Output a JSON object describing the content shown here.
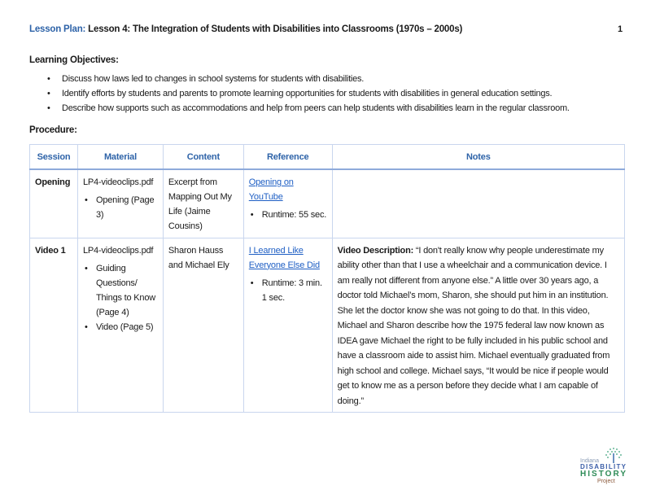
{
  "header": {
    "label": "Lesson Plan:",
    "title": "Lesson 4: The Integration of Students with Disabilities into Classrooms (1970s – 2000s)",
    "page_number": "1"
  },
  "objectives": {
    "heading": "Learning Objectives:",
    "items": [
      "Discuss how laws led to changes in school systems for students with disabilities.",
      "Identify efforts by students and parents to promote learning opportunities for students with disabilities in general education settings.",
      "Describe how supports such as accommodations and help from peers can help students with disabilities learn in the regular classroom."
    ]
  },
  "procedure": {
    "heading": "Procedure:",
    "columns": [
      "Session",
      "Material",
      "Content",
      "Reference",
      "Notes"
    ],
    "rows": [
      {
        "session": "Opening",
        "material_file": "LP4-videoclips.pdf",
        "material_items": [
          "Opening (Page 3)"
        ],
        "content": "Excerpt from Mapping Out My Life (Jaime Cousins)",
        "reference_link": "Opening on YouTube",
        "reference_items": [
          "Runtime: 55 sec."
        ],
        "notes_label": "",
        "notes": ""
      },
      {
        "session": "Video 1",
        "material_file": "LP4-videoclips.pdf",
        "material_items": [
          "Guiding Questions/ Things to Know (Page 4)",
          "Video (Page 5)"
        ],
        "content": "Sharon Hauss and Michael Ely",
        "reference_link": "I Learned Like Everyone Else Did",
        "reference_items": [
          "Runtime: 3 min. 1 sec."
        ],
        "notes_label": "Video Description:",
        "notes": " “I don't really know why people underestimate my ability other than that I use a wheelchair and a communication device. I am really not different from anyone else.” A little over 30 years ago, a doctor told Michael’s mom, Sharon, she should put him in an institution. She let the doctor know she was not going to do that. In this video, Michael and Sharon describe how the 1975 federal law now known as IDEA gave Michael the right to be fully included in his public school and have a classroom aide to assist him. Michael eventually graduated from high school and college. Michael says, “It would be nice if people would get to know me as a person before they decide what I am capable of doing.”"
      }
    ]
  },
  "logo": {
    "line1": "Indiana",
    "line2": "DISABILITY",
    "line3": "HISTORY",
    "line4": "Project"
  },
  "colors": {
    "accent_blue": "#2e63a8",
    "link_blue": "#1f5fc4",
    "table_border": "#c9d6ee",
    "logo_green": "#2e8b57",
    "logo_brown": "#8b5a3c"
  }
}
